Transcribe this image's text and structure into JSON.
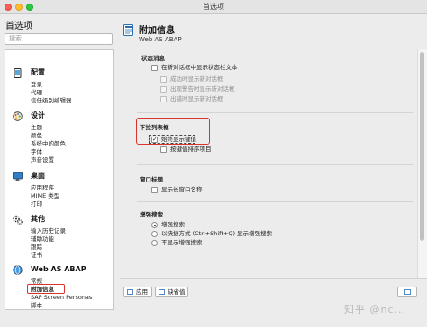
{
  "window": {
    "title": "首选项"
  },
  "sidebar": {
    "title": "首选项",
    "search_placeholder": "搜索",
    "categories": [
      {
        "label": "配置",
        "icon": "phone-settings-icon",
        "items": [
          "登录",
          "代理",
          "信任级别编辑器"
        ]
      },
      {
        "label": "设计",
        "icon": "palette-icon",
        "items": [
          "主题",
          "颜色",
          "系统中的颜色",
          "字体",
          "声音设置"
        ]
      },
      {
        "label": "桌面",
        "icon": "monitor-icon",
        "items": [
          "应用程序",
          "MIME 类型",
          "打印"
        ]
      },
      {
        "label": "其他",
        "icon": "gears-icon",
        "items": [
          "输入历史记录",
          "辅助功能",
          "跟踪",
          "证书"
        ]
      },
      {
        "label": "Web AS ABAP",
        "icon": "globe-icon",
        "items": [
          "常规",
          "附加信息",
          "SAP Screen Personas",
          "脚本"
        ]
      }
    ],
    "selected": "附加信息"
  },
  "panel": {
    "title": "附加信息",
    "subtitle": "Web AS ABAP",
    "sections": {
      "status": {
        "title": "状态消息",
        "show_in_dialog": "在新对话框中显示状态栏文本",
        "success": "成功时显示新对话框",
        "warning": "出现警告时显示新对话框",
        "error": "出错时显示新对话框"
      },
      "dropdown": {
        "title": "下拉列表框",
        "always_show_key": "始终显示键值",
        "sort_by_key": "按键值排序项目"
      },
      "window_title": {
        "title": "窗口标题",
        "show_long_name": "显示长窗口名称"
      },
      "enhanced_search": {
        "title": "增强搜索",
        "options": [
          "增强搜索",
          "以快捷方式 (Ctrl+Shift+Q) 显示增强搜索",
          "不显示增强搜索"
        ],
        "selected_index": 0
      }
    }
  },
  "footer": {
    "apply": "应用",
    "defaults": "缺省值"
  },
  "watermark": "知乎 @nc..."
}
